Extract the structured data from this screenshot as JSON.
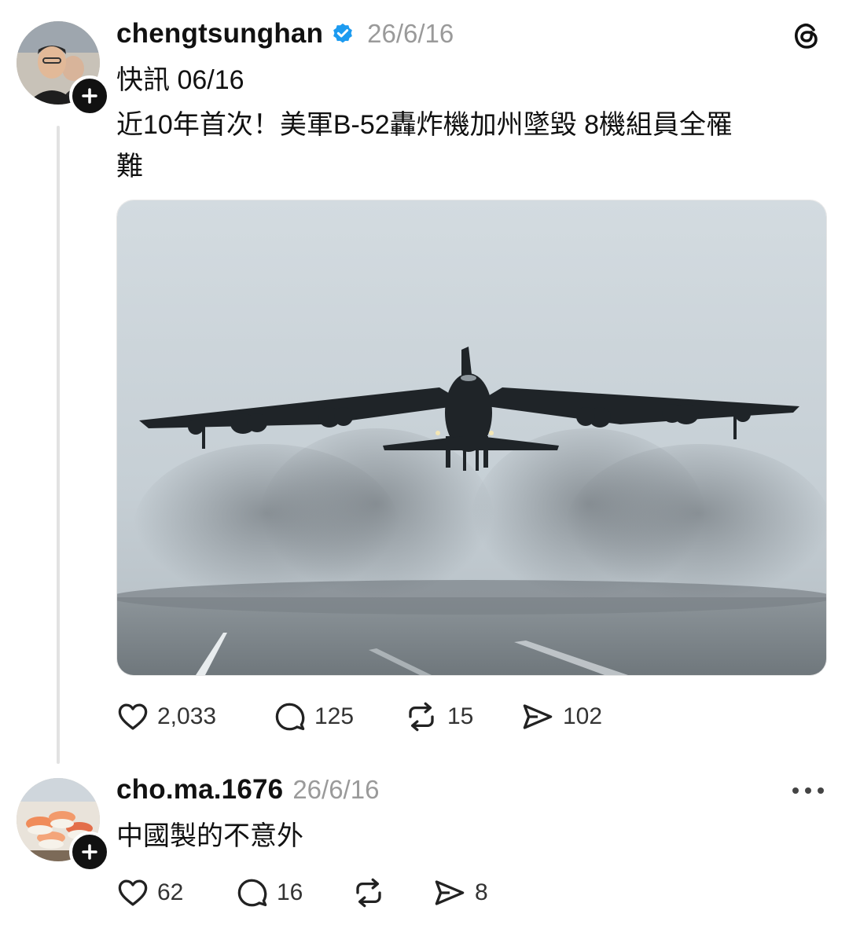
{
  "post": {
    "author": "chengtsunghan",
    "timestamp": "26/6/16",
    "line1": "快訊 06/16",
    "line2": "近10年首次！美軍B-52轟炸機加州墜毀 8機組員全罹",
    "line3": "難",
    "stats": {
      "likes": "2,033",
      "comments": "125",
      "reposts": "15",
      "shares": "102"
    }
  },
  "reply": {
    "author": "cho.ma.1676",
    "timestamp": "26/6/16",
    "text": "中國製的不意外",
    "stats": {
      "likes": "62",
      "comments": "16",
      "reposts": "",
      "shares": "8"
    }
  },
  "icons": {
    "verified": "verified-badge-icon",
    "app": "threads-logo-icon",
    "like": "heart-icon",
    "comment": "comment-bubble-icon",
    "repost": "repost-icon",
    "share": "send-icon",
    "more": "more-dots-icon"
  },
  "colors": {
    "verified": "#1d9bf0",
    "text": "#111111",
    "muted": "#9a9a9a"
  }
}
